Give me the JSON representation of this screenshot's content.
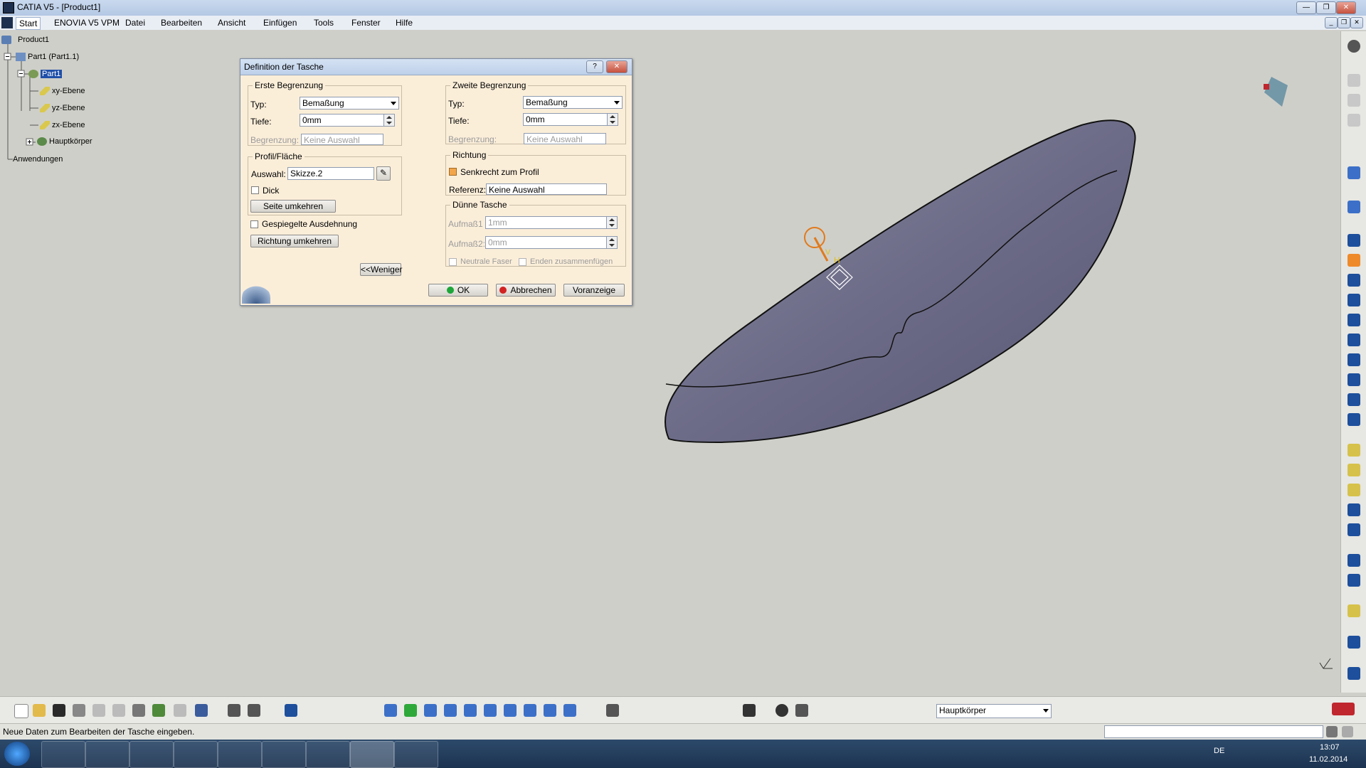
{
  "app": {
    "title": "CATIA V5 - [Product1]"
  },
  "menu": [
    "Start",
    "ENOVIA V5 VPM",
    "Datei",
    "Bearbeiten",
    "Ansicht",
    "Einfügen",
    "Tools",
    "Fenster",
    "Hilfe"
  ],
  "tree": {
    "items": [
      "Product1",
      "Part1 (Part1.1)",
      "Part1",
      "xy-Ebene",
      "yz-Ebene",
      "zx-Ebene",
      "Hauptkörper",
      "Anwendungen"
    ]
  },
  "dialog": {
    "title": "Definition der Tasche",
    "help": "?",
    "close": "✕",
    "first_limit": {
      "legend": "Erste Begrenzung",
      "type_label": "Typ:",
      "type_value": "Bemaßung",
      "depth_label": "Tiefe:",
      "depth_value": "0mm",
      "limit_label": "Begrenzung:",
      "limit_value": "Keine Auswahl"
    },
    "profile": {
      "legend": "Profil/Fläche",
      "selection_label": "Auswahl:",
      "selection_value": "Skizze.2",
      "thick_label": "Dick",
      "reverse_side": "Seite umkehren"
    },
    "mirrored_label": "Gespiegelte Ausdehnung",
    "reverse_direction": "Richtung umkehren",
    "less_button": "<<Weniger",
    "second_limit": {
      "legend": "Zweite Begrenzung",
      "type_label": "Typ:",
      "type_value": "Bemaßung",
      "depth_label": "Tiefe:",
      "depth_value": "0mm",
      "limit_label": "Begrenzung:",
      "limit_value": "Keine Auswahl"
    },
    "direction": {
      "legend": "Richtung",
      "normal_label": "Senkrecht zum Profil",
      "reference_label": "Referenz:",
      "reference_value": "Keine Auswahl"
    },
    "thin": {
      "legend": "Dünne Tasche",
      "thickness1_label": "Aufmaß1",
      "thickness1_value": "1mm",
      "thickness2_label": "Aufmaß2:",
      "thickness2_value": "0mm",
      "neutral_label": "Neutrale Faser",
      "merge_label": "Enden zusammenfügen"
    },
    "ok": "OK",
    "cancel": "Abbrechen",
    "preview": "Voranzeige"
  },
  "toolbar": {
    "body_select": "Hauptkörper"
  },
  "status": {
    "text": "Neue Daten zum Bearbeiten der Tasche eingeben."
  },
  "taskbar": {
    "lang": "DE",
    "time": "13:07",
    "date": "11.02.2014"
  },
  "colors": {
    "accent": "#f2a54a",
    "shape": "#6b6a86",
    "background": "#cfcfc9"
  }
}
